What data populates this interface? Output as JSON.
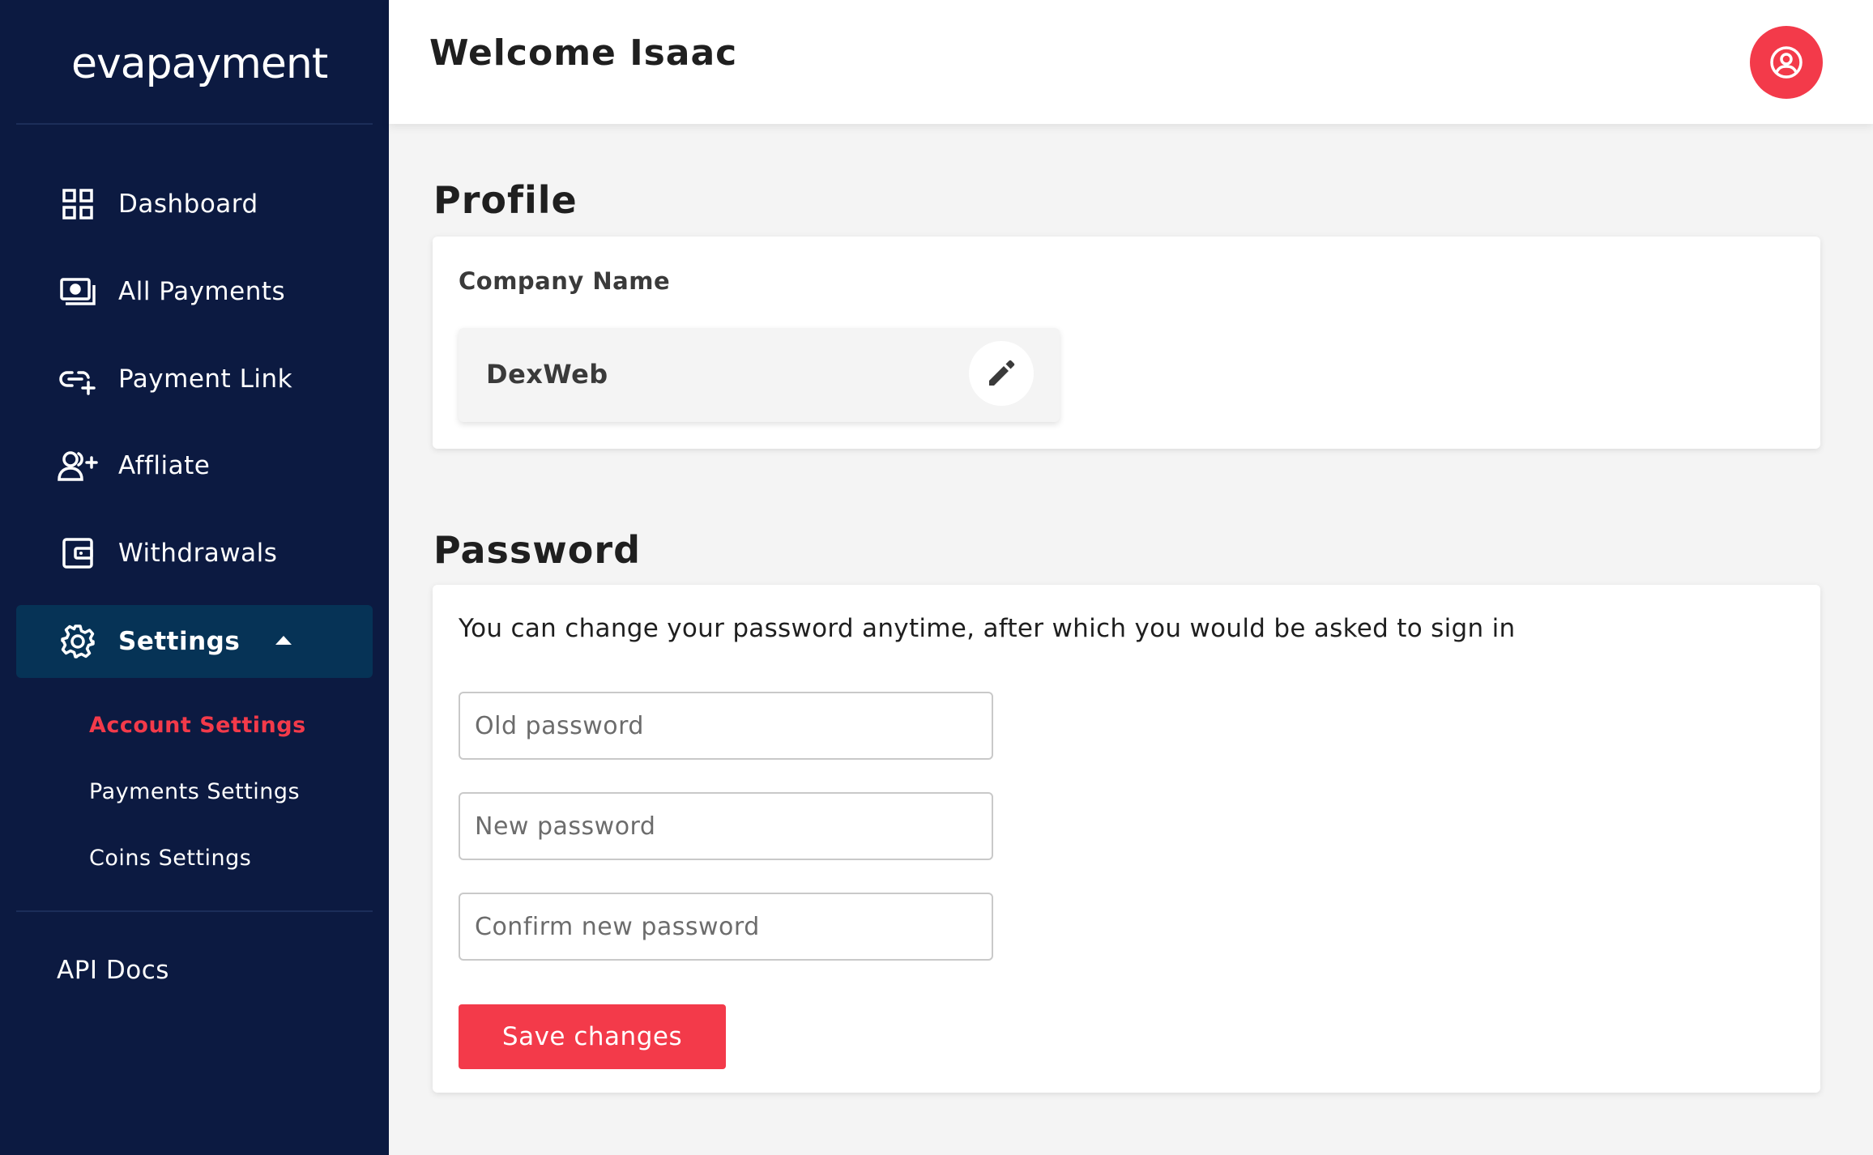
{
  "app": {
    "logo_text": "evapayment",
    "accent_color": "#f33a4a",
    "sidebar_bg": "#0c1a41",
    "sidebar_active_bg": "#063356"
  },
  "sidebar": {
    "items": [
      {
        "label": "Dashboard",
        "icon": "dashboard-grid-icon"
      },
      {
        "label": "All Payments",
        "icon": "payments-cash-icon"
      },
      {
        "label": "Payment Link",
        "icon": "link-plus-icon"
      },
      {
        "label": "Affliate",
        "icon": "user-add-icon"
      },
      {
        "label": "Withdrawals",
        "icon": "wallet-icon"
      },
      {
        "label": "Settings",
        "icon": "gear-icon",
        "expanded": true
      }
    ],
    "settings_sub": [
      {
        "label": "Account Settings",
        "active": true
      },
      {
        "label": "Payments Settings",
        "active": false
      },
      {
        "label": "Coins Settings",
        "active": false
      }
    ],
    "api_docs": "API Docs"
  },
  "header": {
    "welcome": "Welcome Isaac",
    "profile_icon": "user-circle-icon"
  },
  "profile": {
    "title": "Profile",
    "company_label": "Company Name",
    "company_value": "DexWeb",
    "edit_icon": "pencil-icon"
  },
  "password": {
    "title": "Password",
    "description": "You can change your password anytime, after which you would be asked to sign in",
    "old_placeholder": "Old password",
    "new_placeholder": "New password",
    "confirm_placeholder": "Confirm new password",
    "save_label": "Save changes"
  }
}
